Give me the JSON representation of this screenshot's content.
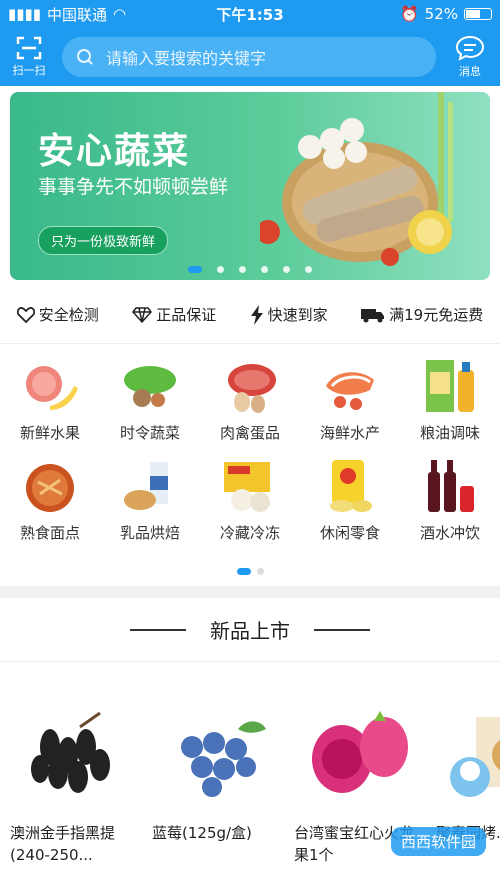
{
  "status": {
    "carrier": "中国联通",
    "time": "下午1:53",
    "battery": "52%"
  },
  "header": {
    "scan_label": "扫一扫",
    "search_placeholder": "请输入要搜索的关键字",
    "message_label": "消息"
  },
  "banner": {
    "title": "安心蔬菜",
    "subtitle": "事事争先不如顿顿尝鲜",
    "pill": "只为一份极致新鲜"
  },
  "features": [
    "安全检测",
    "正品保证",
    "快速到家",
    "满19元免运费"
  ],
  "categories": [
    "新鲜水果",
    "时令蔬菜",
    "肉禽蛋品",
    "海鲜水产",
    "粮油调味",
    "熟食面点",
    "乳品烘焙",
    "冷藏冷冻",
    "休闲零食",
    "酒水冲饮"
  ],
  "new_section": {
    "title": "新品上市"
  },
  "products": [
    {
      "name": "澳洲金手指黑提(240-250..."
    },
    {
      "name": "蓝莓(125g/盒)"
    },
    {
      "name": "台湾蜜宝红心火龙果1个"
    },
    {
      "name": "聚春园烤..."
    }
  ],
  "watermark": "西西软件园",
  "colors": {
    "primary": "#1e9bf0",
    "banner_green": "#39b98a"
  }
}
